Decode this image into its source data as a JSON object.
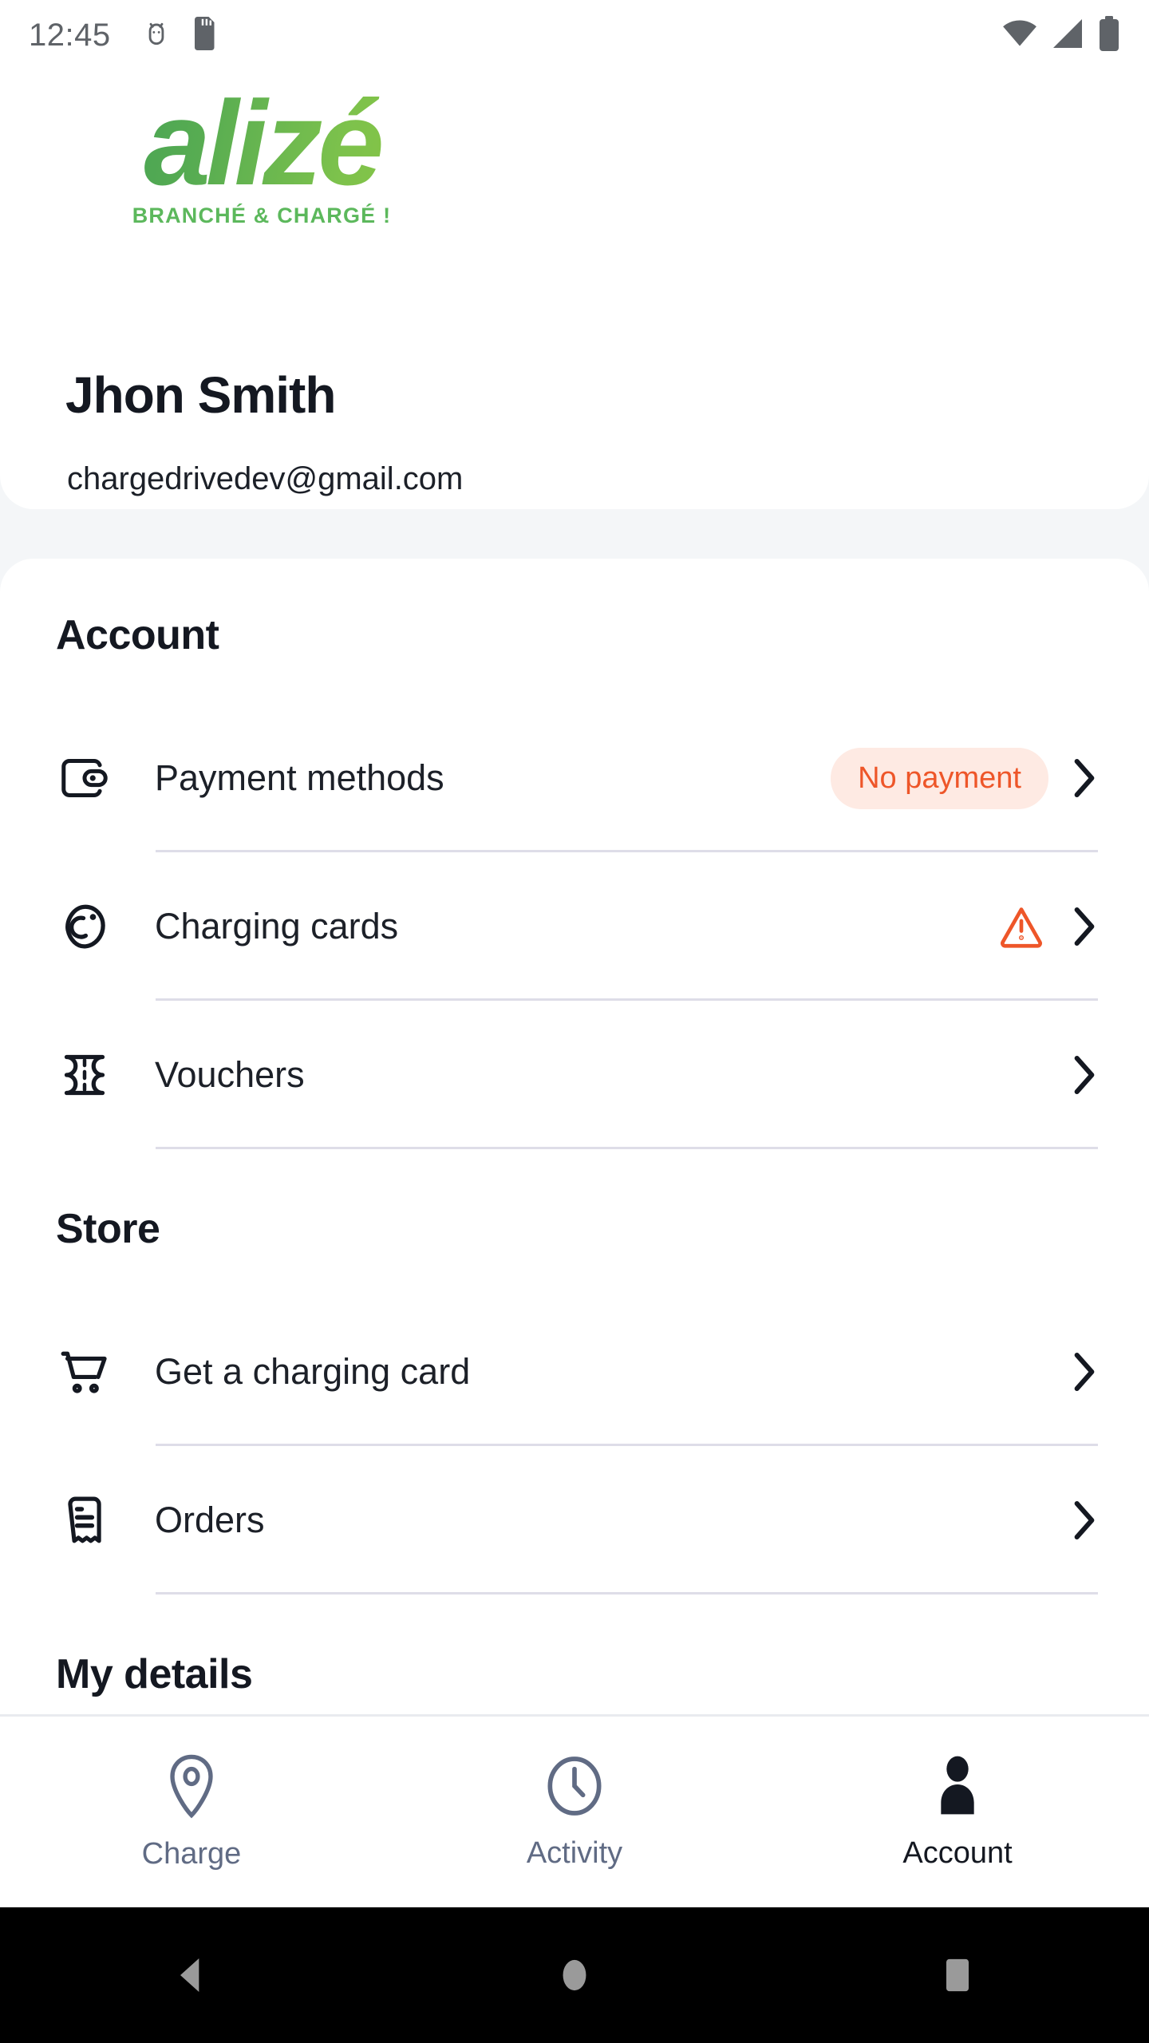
{
  "status_bar": {
    "time": "12:45",
    "left_icons": [
      "android-debug-icon",
      "sd-card-icon"
    ],
    "right_icons": [
      "wifi-icon",
      "cellular-signal-icon",
      "battery-icon"
    ],
    "icon_color": "#5f6368"
  },
  "brand": {
    "wordmark": "alizé",
    "tagline": "BRANCHÉ & CHARGÉ !",
    "green_dark": "#3E9E56",
    "green_light": "#8DC63F",
    "tagline_color": "#5CB85C"
  },
  "profile": {
    "name": "Jhon Smith",
    "email": "chargedrivedev@gmail.com"
  },
  "sections": [
    {
      "title": "Account",
      "rows": [
        {
          "label": "Payment methods",
          "icon": "wallet-icon",
          "badge": "No payment",
          "badge_text_color": "#EE5629",
          "badge_bg_color": "#FEEAE3",
          "warning": false,
          "chevron": "chevron-right-icon"
        },
        {
          "label": "Charging cards",
          "icon": "rfid-badge-icon",
          "badge": null,
          "warning": true,
          "warning_color": "#EE5629",
          "chevron": "chevron-right-icon"
        },
        {
          "label": "Vouchers",
          "icon": "ticket-icon",
          "badge": null,
          "warning": false,
          "chevron": "chevron-right-icon"
        }
      ]
    },
    {
      "title": "Store",
      "rows": [
        {
          "label": "Get a charging card",
          "icon": "shopping-cart-icon",
          "badge": null,
          "warning": false,
          "chevron": "chevron-right-icon"
        },
        {
          "label": "Orders",
          "icon": "receipt-icon",
          "badge": null,
          "warning": false,
          "chevron": "chevron-right-icon"
        }
      ]
    },
    {
      "title": "My details",
      "rows": []
    }
  ],
  "tabbar": {
    "items": [
      {
        "label": "Charge",
        "icon": "map-pin-icon",
        "active": false
      },
      {
        "label": "Activity",
        "icon": "clock-icon",
        "active": false
      },
      {
        "label": "Account",
        "icon": "person-icon",
        "active": true
      }
    ],
    "active_color": "#141821",
    "inactive_color": "#606B84"
  },
  "android_nav": {
    "buttons": [
      "back-triangle-icon",
      "home-circle-icon",
      "recents-square-icon"
    ],
    "icon_color": "#9A9A9A",
    "bg_color": "#000000"
  },
  "theme": {
    "page_bg": "#F4F6F8",
    "card_bg": "#FFFFFF",
    "text_primary": "#141821",
    "divider": "#DEDDE8"
  }
}
